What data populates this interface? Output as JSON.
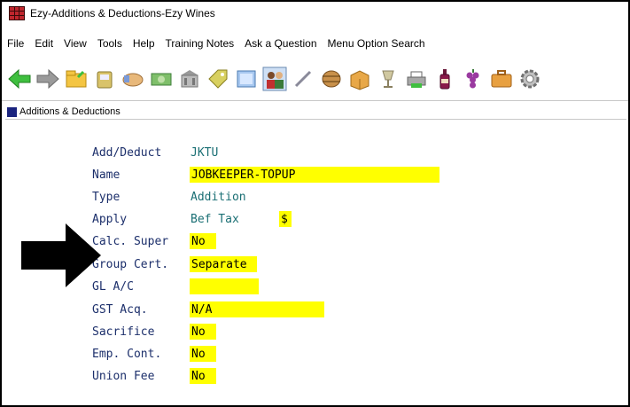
{
  "window": {
    "title": "Ezy-Additions & Deductions-Ezy Wines"
  },
  "menu": {
    "items": [
      "File",
      "Edit",
      "View",
      "Tools",
      "Help",
      "Training Notes",
      "Ask a Question",
      "Menu Option Search"
    ]
  },
  "toolbar": {
    "icons": [
      "back-arrow-icon",
      "forward-arrow-icon",
      "folder-icon",
      "phone-icon",
      "handshake-icon",
      "money-icon",
      "building-icon",
      "tag-icon",
      "card-icon",
      "people-icon",
      "pen-icon",
      "barrel-icon",
      "box-icon",
      "glass-icon",
      "printer-icon",
      "bottle-icon",
      "grapes-icon",
      "briefcase-icon",
      "gear-icon"
    ]
  },
  "panel": {
    "title": "Additions & Deductions"
  },
  "form": {
    "add_deduct_label": "Add/Deduct",
    "add_deduct_value": "JKTU",
    "name_label": "Name",
    "name_value": "JOBKEEPER-TOPUP",
    "type_label": "Type",
    "type_value": "Addition",
    "apply_label": "Apply",
    "apply_value": "Bef Tax",
    "apply_unit": "$",
    "calc_super_label": "Calc. Super",
    "calc_super_value": "No",
    "group_cert_label": "Group Cert.",
    "group_cert_value": "Separate",
    "gl_ac_label": "GL A/C",
    "gl_ac_value": "",
    "gst_acq_label": "GST Acq.",
    "gst_acq_value": "N/A",
    "sacrifice_label": "Sacrifice",
    "sacrifice_value": "No",
    "emp_cont_label": "Emp. Cont.",
    "emp_cont_value": "No",
    "union_fee_label": "Union Fee",
    "union_fee_value": "No"
  },
  "colors": {
    "field_highlight": "#ffff00",
    "label_text": "#1c2f6b",
    "value_text": "#1a6f74",
    "panel_square": "#1a237e"
  }
}
